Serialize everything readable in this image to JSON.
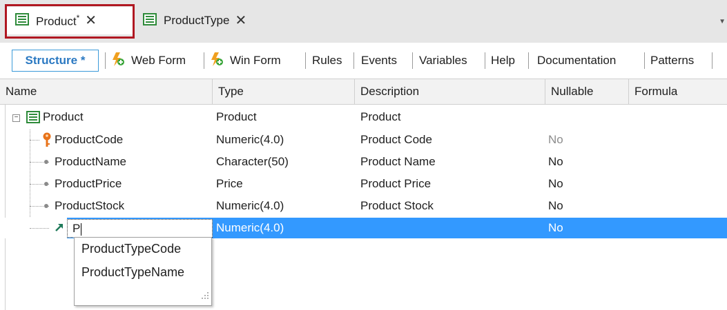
{
  "tabs": [
    {
      "label": "Product",
      "dirty": "*",
      "close": "✕",
      "icon": "transaction-icon"
    },
    {
      "label": "ProductType",
      "close": "✕",
      "icon": "transaction-icon"
    }
  ],
  "overflow_icon": "chevron-down-icon",
  "toolbar": {
    "items": [
      "Structure *",
      "Web Form",
      "Win Form",
      "Rules",
      "Events",
      "Variables",
      "Help",
      "Documentation",
      "Patterns"
    ],
    "active": "Structure *"
  },
  "grid": {
    "columns": [
      "Name",
      "Type",
      "Description",
      "Nullable",
      "Formula"
    ],
    "root": {
      "name": "Product",
      "type": "Product",
      "description": "Product"
    },
    "rows": [
      {
        "name": "ProductCode",
        "type": "Numeric(4.0)",
        "description": "Product Code",
        "nullable": "No",
        "icon": "key-icon"
      },
      {
        "name": "ProductName",
        "type": "Character(50)",
        "description": "Product Name",
        "nullable": "No",
        "icon": "attribute-dot-icon"
      },
      {
        "name": "ProductPrice",
        "type": "Price",
        "description": "Product Price",
        "nullable": "No",
        "icon": "attribute-dot-icon"
      },
      {
        "name": "ProductStock",
        "type": "Numeric(4.0)",
        "description": "Product Stock",
        "nullable": "No",
        "icon": "attribute-dot-icon"
      }
    ],
    "editing_row": {
      "name": "P",
      "type": "Numeric(4.0)",
      "nullable": "No",
      "icon": "foreign-key-arrow-icon"
    }
  },
  "autocomplete": {
    "items": [
      "ProductTypeCode",
      "ProductTypeName"
    ]
  },
  "colors": {
    "selection": "#3399ff",
    "active_tab_border": "#b01721",
    "structure_text": "#2b79c2"
  }
}
